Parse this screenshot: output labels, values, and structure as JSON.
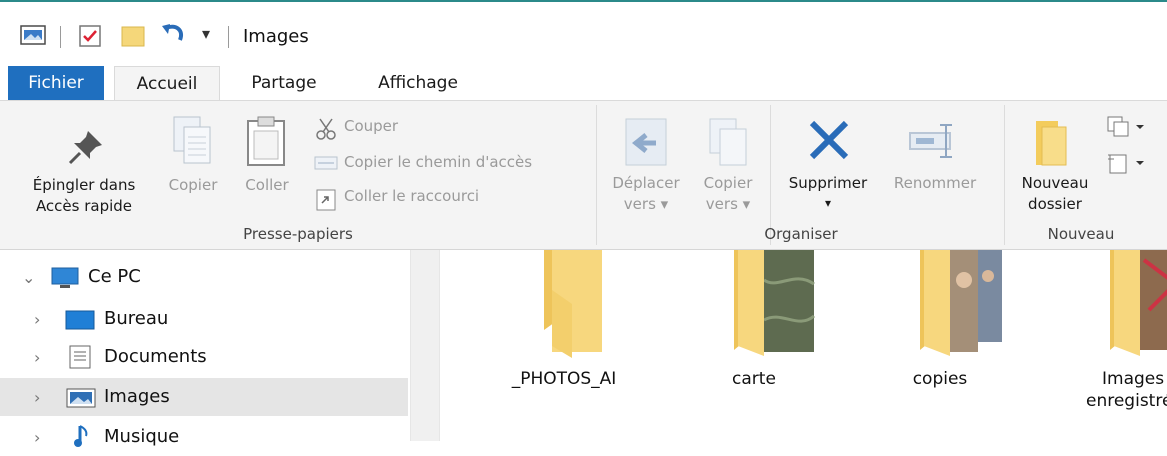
{
  "window": {
    "title": "Images"
  },
  "tabs": {
    "file": "Fichier",
    "home": "Accueil",
    "share": "Partage",
    "view": "Affichage"
  },
  "ribbon": {
    "clipboard": {
      "label": "Presse-papiers",
      "pin_line1": "Épingler dans",
      "pin_line2": "Accès rapide",
      "copy": "Copier",
      "paste": "Coller",
      "cut": "Couper",
      "copy_path": "Copier le chemin d'accès",
      "paste_shortcut": "Coller le raccourci"
    },
    "organize": {
      "label": "Organiser",
      "move_line1": "Déplacer",
      "move_line2": "vers",
      "copyto_line1": "Copier",
      "copyto_line2": "vers",
      "delete": "Supprimer",
      "rename": "Renommer"
    },
    "new": {
      "label": "Nouveau",
      "folder_line1": "Nouveau",
      "folder_line2": "dossier"
    }
  },
  "nav": {
    "items": [
      {
        "label": "Ce PC"
      },
      {
        "label": "Bureau"
      },
      {
        "label": "Documents"
      },
      {
        "label": "Images"
      },
      {
        "label": "Musique"
      }
    ]
  },
  "content": {
    "folders": [
      {
        "name": "_PHOTOS_AI"
      },
      {
        "name": "carte"
      },
      {
        "name": "copies"
      },
      {
        "name_line1": "Images",
        "name_line2": "enregistrées"
      }
    ]
  },
  "colors": {
    "accent": "#1f6fbf",
    "folder": "#f5d77a",
    "delete": "#2a6cb8"
  }
}
